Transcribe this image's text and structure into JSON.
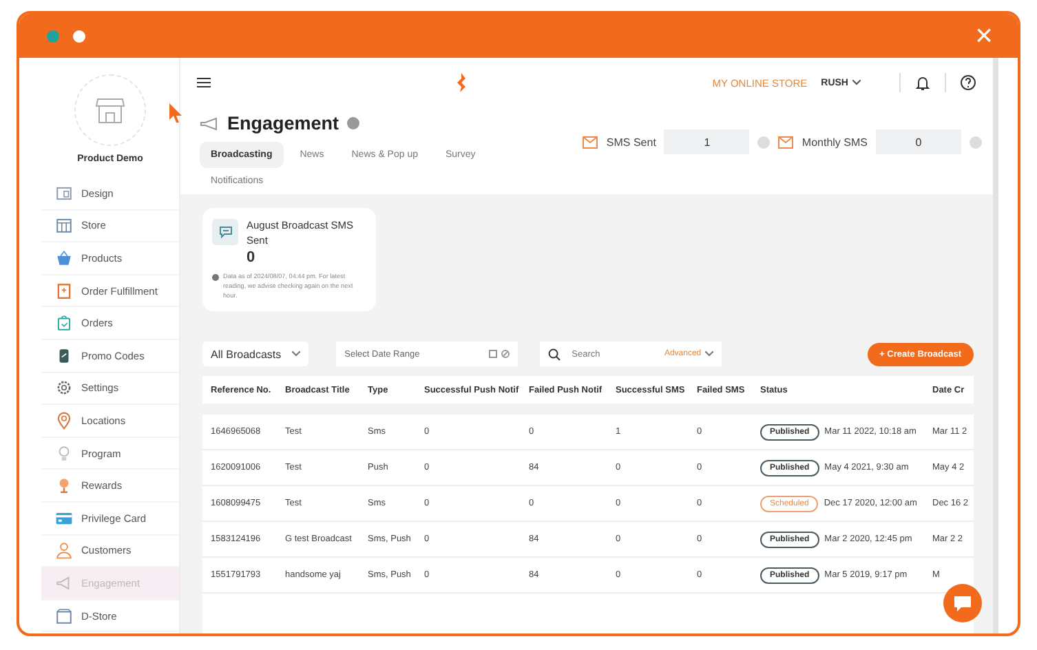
{
  "window": {
    "close": "×"
  },
  "sidebar": {
    "store_name": "Product Demo",
    "items": [
      {
        "label": "Design",
        "selected": false
      },
      {
        "label": "Store",
        "selected": false
      },
      {
        "label": "Products",
        "selected": false
      },
      {
        "label": "Order Fulfillment",
        "selected": false
      },
      {
        "label": "Orders",
        "selected": false
      },
      {
        "label": "Promo Codes",
        "selected": false
      },
      {
        "label": "Settings",
        "selected": false
      },
      {
        "label": "Locations",
        "selected": false
      },
      {
        "label": "Program",
        "selected": false
      },
      {
        "label": "Rewards",
        "selected": false
      },
      {
        "label": "Privilege Card",
        "selected": false
      },
      {
        "label": "Customers",
        "selected": false
      },
      {
        "label": "Engagement",
        "selected": true
      },
      {
        "label": "D-Store",
        "selected": false
      }
    ]
  },
  "topbar": {
    "store_link": "MY ONLINE STORE",
    "account": "RUSH"
  },
  "page": {
    "title": "Engagement"
  },
  "counters": [
    {
      "label": "SMS Sent",
      "value": "1"
    },
    {
      "label": "Monthly SMS",
      "value": "0"
    }
  ],
  "tabs": [
    {
      "label": "Broadcasting",
      "selected": true
    },
    {
      "label": "News",
      "selected": false
    },
    {
      "label": "News & Pop up",
      "selected": false
    },
    {
      "label": "Survey",
      "selected": false
    },
    {
      "label": "Notifications",
      "selected": false
    }
  ],
  "stat_card": {
    "title": "August Broadcast SMS Sent",
    "value": "0",
    "note": "Data as of 2024/08/07, 04:44 pm. For latest reading, we advise checking again on the next hour."
  },
  "filters": {
    "type": "All Broadcasts",
    "date_range": {
      "placeholder": "Select Date Range"
    },
    "search": {
      "placeholder": "Search"
    },
    "advanced": "Advanced",
    "create_button": "+ Create Broadcast"
  },
  "table": {
    "columns": [
      "Reference No.",
      "Broadcast Title",
      "Type",
      "Successful Push Notif",
      "Failed Push Notif",
      "Successful SMS",
      "Failed SMS",
      "Status",
      "Date Cr"
    ],
    "rows": [
      {
        "reference": "1646965068",
        "title": "Test",
        "type": "Sms",
        "push_ok": "0",
        "push_failed": "0",
        "sms_ok": "1",
        "sms_failed": "0",
        "status": {
          "kind": "published",
          "label": "Published"
        },
        "status_date": "Mar 11 2022, 10:18 am",
        "date_created": "Mar 11 2"
      },
      {
        "reference": "1620091006",
        "title": "Test",
        "type": "Push",
        "push_ok": "0",
        "push_failed": "84",
        "sms_ok": "0",
        "sms_failed": "0",
        "status": {
          "kind": "published",
          "label": "Published"
        },
        "status_date": "May 4 2021, 9:30 am",
        "date_created": "May 4 2"
      },
      {
        "reference": "1608099475",
        "title": "Test",
        "type": "Sms",
        "push_ok": "0",
        "push_failed": "0",
        "sms_ok": "0",
        "sms_failed": "0",
        "status": {
          "kind": "scheduled",
          "label": "Scheduled"
        },
        "status_date": "Dec 17 2020, 12:00 am",
        "date_created": "Dec 16 2"
      },
      {
        "reference": "1583124196",
        "title": "G test Broadcast",
        "type": "Sms, Push",
        "push_ok": "0",
        "push_failed": "84",
        "sms_ok": "0",
        "sms_failed": "0",
        "status": {
          "kind": "published",
          "label": "Published"
        },
        "status_date": "Mar 2 2020, 12:45 pm",
        "date_created": "Mar 2 2"
      },
      {
        "reference": "1551791793",
        "title": "handsome yaj",
        "type": "Sms, Push",
        "push_ok": "0",
        "push_failed": "84",
        "sms_ok": "0",
        "sms_failed": "0",
        "status": {
          "kind": "published",
          "label": "Published"
        },
        "status_date": "Mar 5 2019, 9:17 pm",
        "date_created": "M"
      }
    ]
  }
}
